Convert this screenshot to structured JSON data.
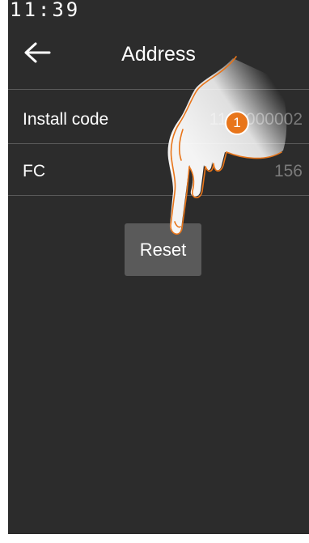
{
  "status_bar": {
    "time": "11:39"
  },
  "header": {
    "title": "Address",
    "back_icon": "arrow-left-icon"
  },
  "rows": [
    {
      "label": "Install code",
      "value": "1100000002"
    },
    {
      "label": "FC",
      "value": "156"
    }
  ],
  "reset_button": {
    "label": "Reset"
  },
  "annotation": {
    "step_number": "1",
    "accent_color": "#e8751a"
  },
  "colors": {
    "screen_background": "#2c2c2c",
    "value_text": "#7a7a7a",
    "button_background": "#5a5a5a"
  }
}
